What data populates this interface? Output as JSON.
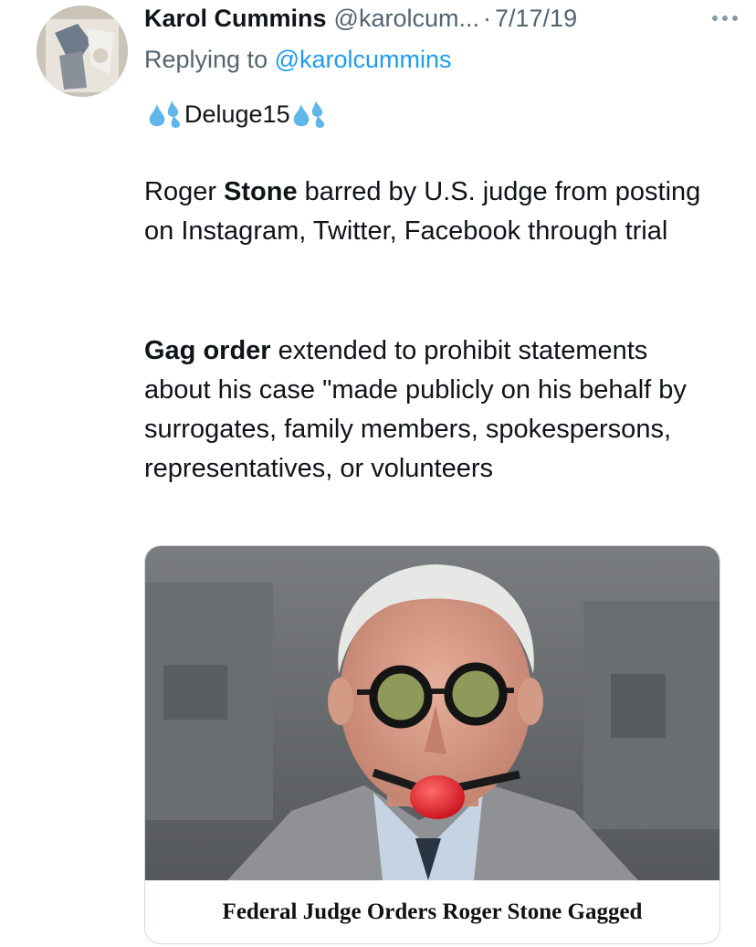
{
  "tweet": {
    "display_name": "Karol Cummins",
    "handle": "@karolcum...",
    "separator": "·",
    "date": "7/17/19",
    "more_icon": "more-horizontal-icon",
    "reply_prefix": "Replying to",
    "reply_mention": "@karolcummins",
    "tag_text": "Deluge15",
    "tag_icon": "sweat-droplets-emoji",
    "para1": {
      "t1": "Roger ",
      "b1": "Stone",
      "t2": " barred by U.S. judge from posting on Instagram, Twitter, Facebook through trial"
    },
    "para2": {
      "b1": "Gag order",
      "t1": " extended to prohibit statements about his case \"made publicly on his behalf by surrogates, family members, spokespersons, representatives, or volunteers"
    },
    "card": {
      "caption": "Federal Judge Orders Roger Stone Gagged"
    }
  },
  "colors": {
    "text": "#0f1419",
    "secondary": "#536471",
    "link": "#1d9bf0",
    "border": "#cfd9de",
    "gag_ball": "#e3182b"
  }
}
